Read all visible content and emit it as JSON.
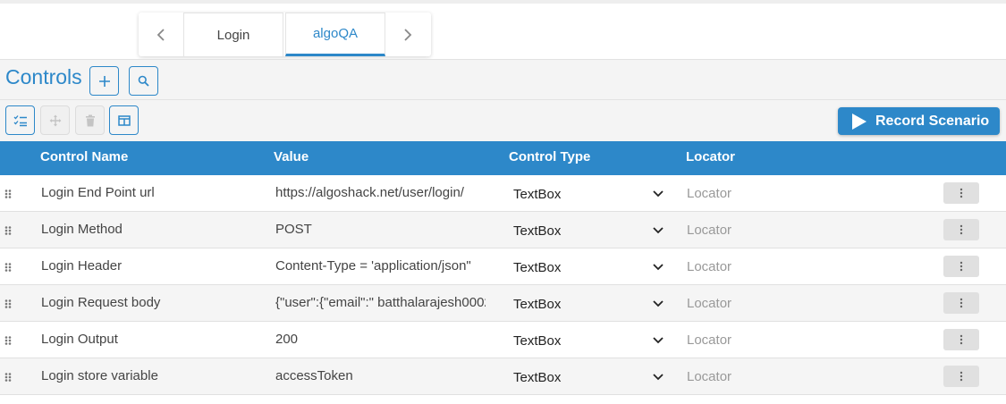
{
  "tabs": {
    "items": [
      {
        "label": "Login"
      },
      {
        "label": "algoQA"
      }
    ]
  },
  "controls": {
    "title": "Controls"
  },
  "toolbar": {
    "record_label": "Record Scenario"
  },
  "table": {
    "headers": {
      "name": "Control Name",
      "value": "Value",
      "type": "Control Type",
      "locator": "Locator"
    },
    "locator_placeholder": "Locator",
    "rows": [
      {
        "name": "Login End Point url",
        "value": "https://algoshack.net/user/login/",
        "type": "TextBox"
      },
      {
        "name": "Login Method",
        "value": "POST",
        "type": "TextBox"
      },
      {
        "name": "Login Header",
        "value": "Content-Type = 'application/json\"",
        "type": "TextBox"
      },
      {
        "name": "Login Request body",
        "value": "{\"user\":{\"email\":\" batthalarajesh0002",
        "type": "TextBox"
      },
      {
        "name": "Login Output",
        "value": "200",
        "type": "TextBox"
      },
      {
        "name": "Login store variable",
        "value": "accessToken",
        "type": "TextBox"
      }
    ]
  },
  "colors": {
    "accent": "#2d88c9",
    "header_bg": "#2d88c9",
    "bar_bg": "#f4f4f4"
  }
}
